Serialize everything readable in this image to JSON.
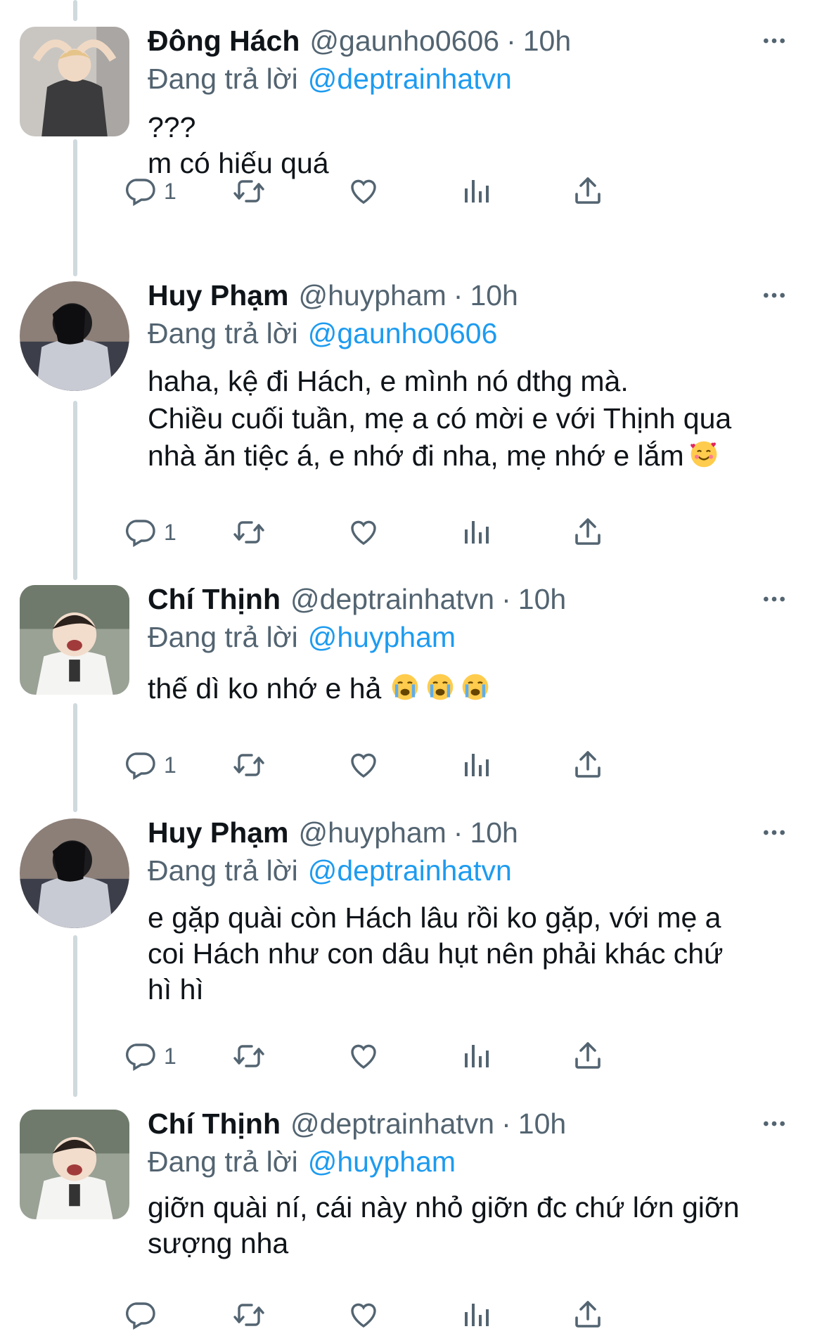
{
  "accent_color": "#1d9bf0",
  "muted_color": "#536471",
  "labels": {
    "replying_to": "Đang trả lời"
  },
  "tweets": [
    {
      "name": "Đông Hách",
      "handle": "@gaunho0606",
      "time": "10h",
      "reply_to": "@deptrainhatvn",
      "text": "???\nm có hiếu quá",
      "reply_count": "1",
      "avatar": "avatar-donghach"
    },
    {
      "name": "Huy Phạm",
      "handle": "@huypham",
      "time": "10h",
      "reply_to": "@gaunho0606",
      "text": "haha, kệ đi Hách, e mình nó dthg mà.\nChiều cuối tuần, mẹ a có mời e với Thịnh qua\nnhà ăn tiệc á, e nhớ đi nha, mẹ nhớ e lắm",
      "reply_count": "1",
      "avatar": "avatar-huypham",
      "emoji": "smiling-face-with-hearts"
    },
    {
      "name": "Chí Thịnh",
      "handle": "@deptrainhatvn",
      "time": "10h",
      "reply_to": "@huypham",
      "text": "thế dì ko nhớ e hả",
      "reply_count": "1",
      "avatar": "avatar-chithinh",
      "emoji": "loudly-crying-face x3"
    },
    {
      "name": "Huy Phạm",
      "handle": "@huypham",
      "time": "10h",
      "reply_to": "@deptrainhatvn",
      "text": "e gặp quài còn Hách lâu rồi ko gặp, với mẹ a\ncoi Hách như con dâu hụt nên phải khác chứ\nhì hì",
      "reply_count": "1",
      "avatar": "avatar-huypham"
    },
    {
      "name": "Chí Thịnh",
      "handle": "@deptrainhatvn",
      "time": "10h",
      "reply_to": "@huypham",
      "text": "giỡn quài ní, cái này nhỏ giỡn đc chứ lớn giỡn\nsượng nha",
      "reply_count": "",
      "avatar": "avatar-chithinh"
    }
  ]
}
